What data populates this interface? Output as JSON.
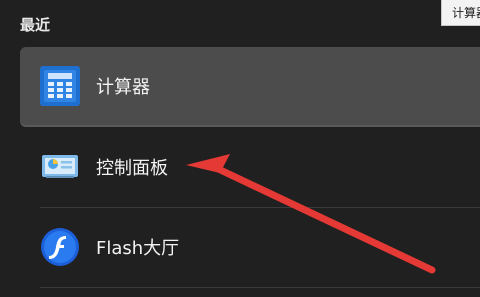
{
  "section": {
    "title": "最近"
  },
  "tooltip": {
    "text": "计算器"
  },
  "recent_items": [
    {
      "label": "计算器",
      "icon": "calculator-icon"
    },
    {
      "label": "控制面板",
      "icon": "control-panel-icon"
    },
    {
      "label": "Flash大厅",
      "icon": "flash-icon"
    }
  ],
  "colors": {
    "background": "#202020",
    "selected": "#4c4c4c",
    "arrow": "#e53935"
  }
}
